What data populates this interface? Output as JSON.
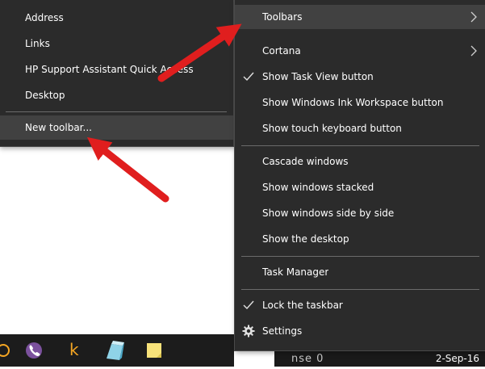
{
  "toolbars_submenu": {
    "items": [
      {
        "label": "Address"
      },
      {
        "label": "Links"
      },
      {
        "label": "HP Support Assistant Quick Access"
      },
      {
        "label": "Desktop"
      },
      {
        "label": "New toolbar..."
      }
    ]
  },
  "context_menu": {
    "toolbars_label": "Toolbars",
    "cortana_label": "Cortana",
    "task_view_label": "Show Task View button",
    "ink_workspace_label": "Show Windows Ink Workspace button",
    "touch_keyboard_label": "Show touch keyboard button",
    "cascade_label": "Cascade windows",
    "stacked_label": "Show windows stacked",
    "side_by_side_label": "Show windows side by side",
    "show_desktop_label": "Show the desktop",
    "task_manager_label": "Task Manager",
    "lock_taskbar_label": "Lock the taskbar",
    "settings_label": "Settings"
  },
  "taskbar": {
    "app_k_letter": "k",
    "tray_text": "nse 0",
    "date": "2-Sep-16"
  },
  "colors": {
    "menu_bg": "#2b2b2b",
    "highlight": "#414141",
    "separator": "#6b6b6b",
    "arrow": "#e01e1e",
    "viber": "#7b519d",
    "kindle_k": "#f5a623"
  }
}
